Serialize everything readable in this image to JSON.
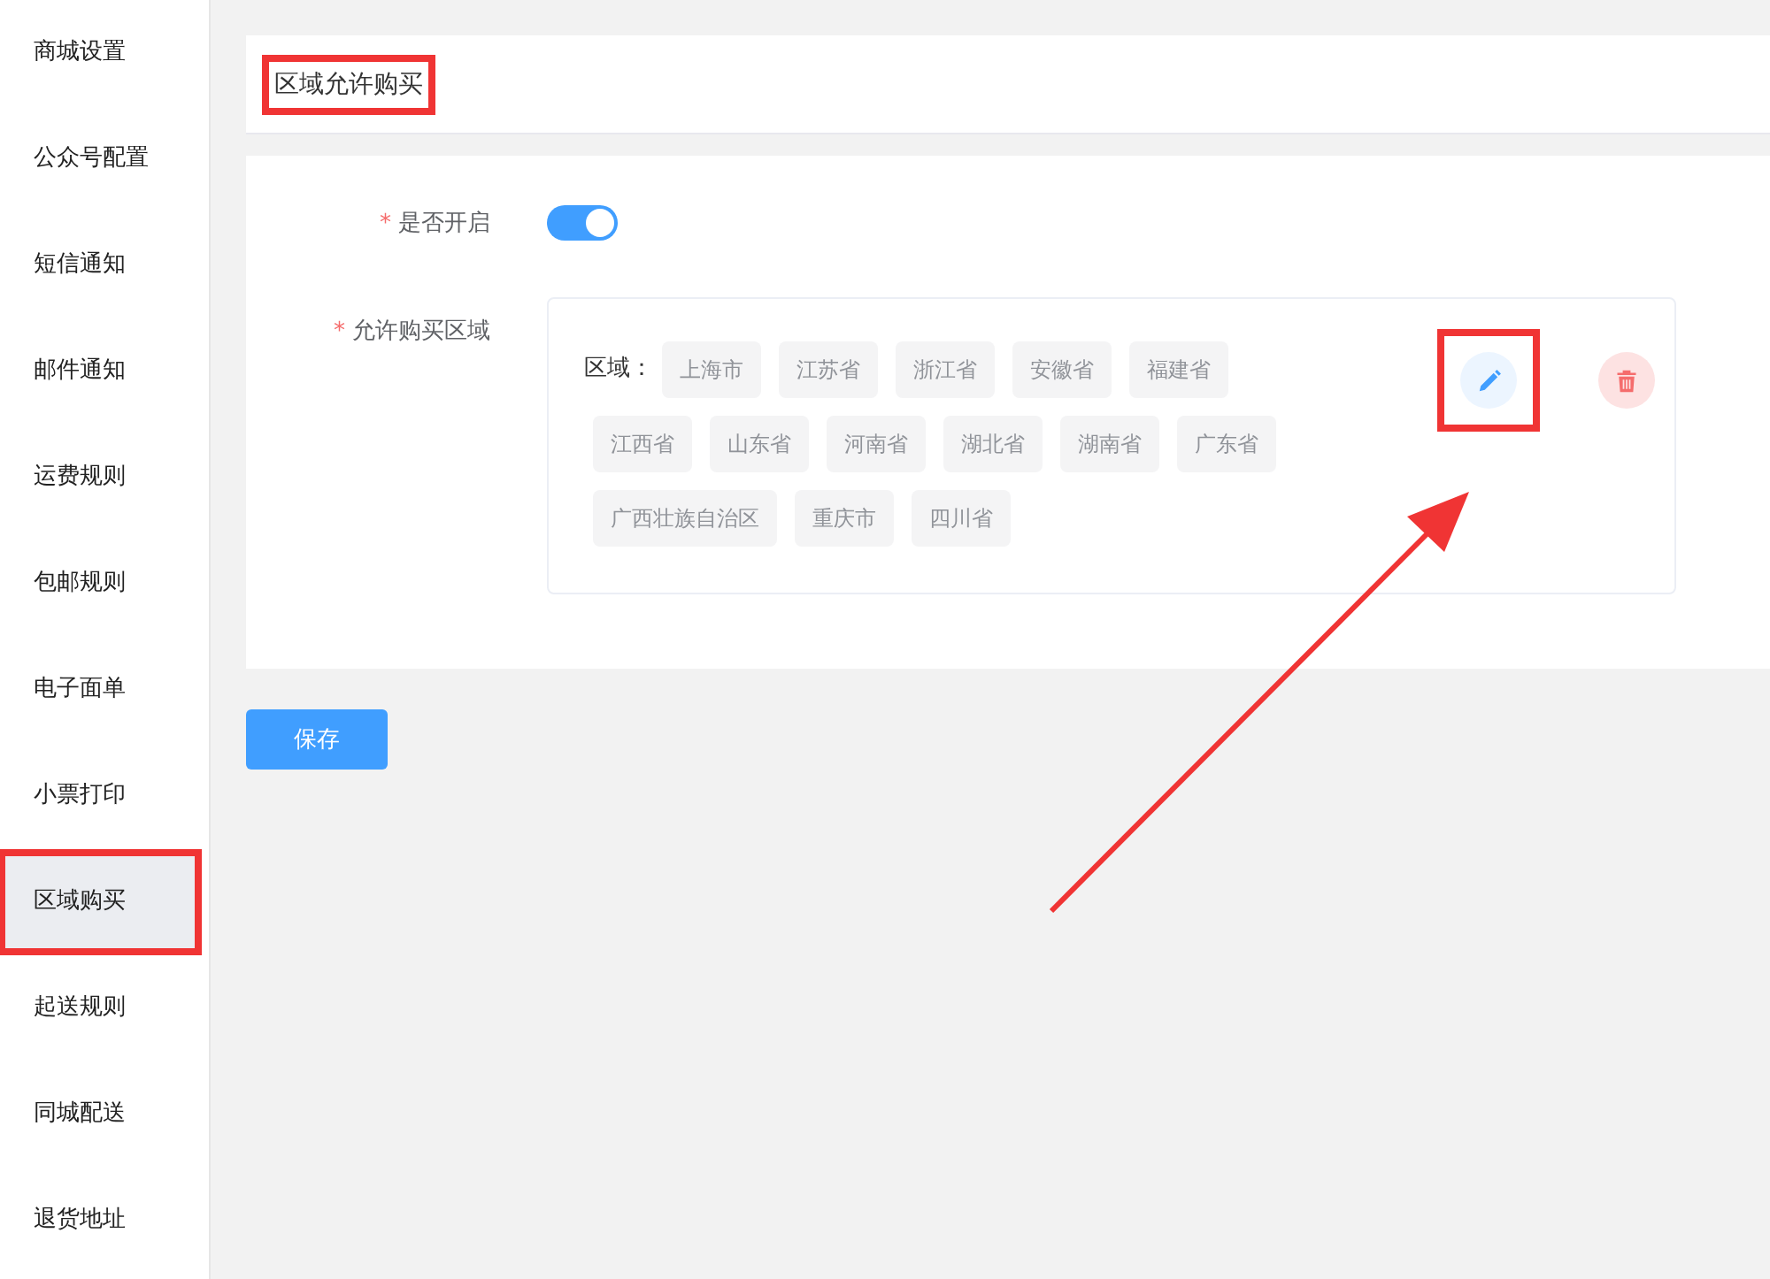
{
  "sidebar": {
    "items": [
      {
        "label": "商城设置",
        "selected": false,
        "annotated": false
      },
      {
        "label": "公众号配置",
        "selected": false,
        "annotated": false
      },
      {
        "label": "短信通知",
        "selected": false,
        "annotated": false
      },
      {
        "label": "邮件通知",
        "selected": false,
        "annotated": false
      },
      {
        "label": "运费规则",
        "selected": false,
        "annotated": false
      },
      {
        "label": "包邮规则",
        "selected": false,
        "annotated": false
      },
      {
        "label": "电子面单",
        "selected": false,
        "annotated": false
      },
      {
        "label": "小票打印",
        "selected": false,
        "annotated": false
      },
      {
        "label": "区域购买",
        "selected": true,
        "annotated": true
      },
      {
        "label": "起送规则",
        "selected": false,
        "annotated": false
      },
      {
        "label": "同城配送",
        "selected": false,
        "annotated": false
      },
      {
        "label": "退货地址",
        "selected": false,
        "annotated": false
      }
    ]
  },
  "header": {
    "title": "区域允许购买",
    "annotated": true
  },
  "form": {
    "enable": {
      "required_mark": "*",
      "label": "是否开启",
      "on": true
    },
    "regions": {
      "required_mark": "*",
      "label": "允许购买区域",
      "rule": {
        "label": "区域：",
        "tags": [
          "上海市",
          "江苏省",
          "浙江省",
          "安徽省",
          "福建省",
          "江西省",
          "山东省",
          "河南省",
          "湖北省",
          "湖南省",
          "广东省",
          "广西壮族自治区",
          "重庆市",
          "四川省"
        ],
        "edit_annotated": true
      }
    }
  },
  "save_button": "保存"
}
